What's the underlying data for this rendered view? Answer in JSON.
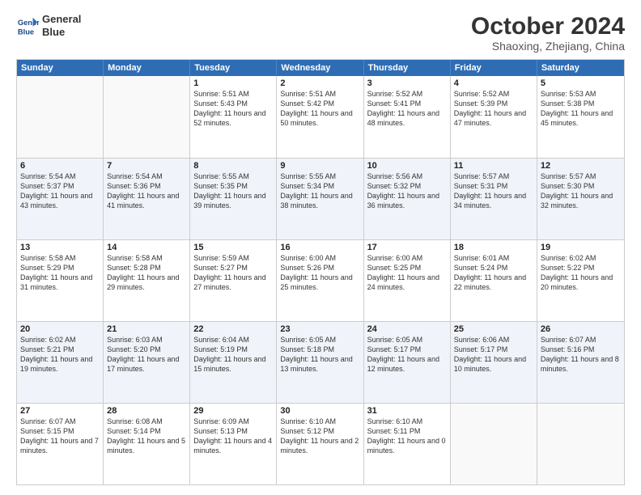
{
  "header": {
    "logo_line1": "General",
    "logo_line2": "Blue",
    "month": "October 2024",
    "location": "Shaoxing, Zhejiang, China"
  },
  "days_of_week": [
    "Sunday",
    "Monday",
    "Tuesday",
    "Wednesday",
    "Thursday",
    "Friday",
    "Saturday"
  ],
  "weeks": [
    [
      {
        "day": "",
        "sunrise": "",
        "sunset": "",
        "daylight": "",
        "empty": true
      },
      {
        "day": "",
        "sunrise": "",
        "sunset": "",
        "daylight": "",
        "empty": true
      },
      {
        "day": "1",
        "sunrise": "Sunrise: 5:51 AM",
        "sunset": "Sunset: 5:43 PM",
        "daylight": "Daylight: 11 hours and 52 minutes."
      },
      {
        "day": "2",
        "sunrise": "Sunrise: 5:51 AM",
        "sunset": "Sunset: 5:42 PM",
        "daylight": "Daylight: 11 hours and 50 minutes."
      },
      {
        "day": "3",
        "sunrise": "Sunrise: 5:52 AM",
        "sunset": "Sunset: 5:41 PM",
        "daylight": "Daylight: 11 hours and 48 minutes."
      },
      {
        "day": "4",
        "sunrise": "Sunrise: 5:52 AM",
        "sunset": "Sunset: 5:39 PM",
        "daylight": "Daylight: 11 hours and 47 minutes."
      },
      {
        "day": "5",
        "sunrise": "Sunrise: 5:53 AM",
        "sunset": "Sunset: 5:38 PM",
        "daylight": "Daylight: 11 hours and 45 minutes."
      }
    ],
    [
      {
        "day": "6",
        "sunrise": "Sunrise: 5:54 AM",
        "sunset": "Sunset: 5:37 PM",
        "daylight": "Daylight: 11 hours and 43 minutes."
      },
      {
        "day": "7",
        "sunrise": "Sunrise: 5:54 AM",
        "sunset": "Sunset: 5:36 PM",
        "daylight": "Daylight: 11 hours and 41 minutes."
      },
      {
        "day": "8",
        "sunrise": "Sunrise: 5:55 AM",
        "sunset": "Sunset: 5:35 PM",
        "daylight": "Daylight: 11 hours and 39 minutes."
      },
      {
        "day": "9",
        "sunrise": "Sunrise: 5:55 AM",
        "sunset": "Sunset: 5:34 PM",
        "daylight": "Daylight: 11 hours and 38 minutes."
      },
      {
        "day": "10",
        "sunrise": "Sunrise: 5:56 AM",
        "sunset": "Sunset: 5:32 PM",
        "daylight": "Daylight: 11 hours and 36 minutes."
      },
      {
        "day": "11",
        "sunrise": "Sunrise: 5:57 AM",
        "sunset": "Sunset: 5:31 PM",
        "daylight": "Daylight: 11 hours and 34 minutes."
      },
      {
        "day": "12",
        "sunrise": "Sunrise: 5:57 AM",
        "sunset": "Sunset: 5:30 PM",
        "daylight": "Daylight: 11 hours and 32 minutes."
      }
    ],
    [
      {
        "day": "13",
        "sunrise": "Sunrise: 5:58 AM",
        "sunset": "Sunset: 5:29 PM",
        "daylight": "Daylight: 11 hours and 31 minutes."
      },
      {
        "day": "14",
        "sunrise": "Sunrise: 5:58 AM",
        "sunset": "Sunset: 5:28 PM",
        "daylight": "Daylight: 11 hours and 29 minutes."
      },
      {
        "day": "15",
        "sunrise": "Sunrise: 5:59 AM",
        "sunset": "Sunset: 5:27 PM",
        "daylight": "Daylight: 11 hours and 27 minutes."
      },
      {
        "day": "16",
        "sunrise": "Sunrise: 6:00 AM",
        "sunset": "Sunset: 5:26 PM",
        "daylight": "Daylight: 11 hours and 25 minutes."
      },
      {
        "day": "17",
        "sunrise": "Sunrise: 6:00 AM",
        "sunset": "Sunset: 5:25 PM",
        "daylight": "Daylight: 11 hours and 24 minutes."
      },
      {
        "day": "18",
        "sunrise": "Sunrise: 6:01 AM",
        "sunset": "Sunset: 5:24 PM",
        "daylight": "Daylight: 11 hours and 22 minutes."
      },
      {
        "day": "19",
        "sunrise": "Sunrise: 6:02 AM",
        "sunset": "Sunset: 5:22 PM",
        "daylight": "Daylight: 11 hours and 20 minutes."
      }
    ],
    [
      {
        "day": "20",
        "sunrise": "Sunrise: 6:02 AM",
        "sunset": "Sunset: 5:21 PM",
        "daylight": "Daylight: 11 hours and 19 minutes."
      },
      {
        "day": "21",
        "sunrise": "Sunrise: 6:03 AM",
        "sunset": "Sunset: 5:20 PM",
        "daylight": "Daylight: 11 hours and 17 minutes."
      },
      {
        "day": "22",
        "sunrise": "Sunrise: 6:04 AM",
        "sunset": "Sunset: 5:19 PM",
        "daylight": "Daylight: 11 hours and 15 minutes."
      },
      {
        "day": "23",
        "sunrise": "Sunrise: 6:05 AM",
        "sunset": "Sunset: 5:18 PM",
        "daylight": "Daylight: 11 hours and 13 minutes."
      },
      {
        "day": "24",
        "sunrise": "Sunrise: 6:05 AM",
        "sunset": "Sunset: 5:17 PM",
        "daylight": "Daylight: 11 hours and 12 minutes."
      },
      {
        "day": "25",
        "sunrise": "Sunrise: 6:06 AM",
        "sunset": "Sunset: 5:17 PM",
        "daylight": "Daylight: 11 hours and 10 minutes."
      },
      {
        "day": "26",
        "sunrise": "Sunrise: 6:07 AM",
        "sunset": "Sunset: 5:16 PM",
        "daylight": "Daylight: 11 hours and 8 minutes."
      }
    ],
    [
      {
        "day": "27",
        "sunrise": "Sunrise: 6:07 AM",
        "sunset": "Sunset: 5:15 PM",
        "daylight": "Daylight: 11 hours and 7 minutes."
      },
      {
        "day": "28",
        "sunrise": "Sunrise: 6:08 AM",
        "sunset": "Sunset: 5:14 PM",
        "daylight": "Daylight: 11 hours and 5 minutes."
      },
      {
        "day": "29",
        "sunrise": "Sunrise: 6:09 AM",
        "sunset": "Sunset: 5:13 PM",
        "daylight": "Daylight: 11 hours and 4 minutes."
      },
      {
        "day": "30",
        "sunrise": "Sunrise: 6:10 AM",
        "sunset": "Sunset: 5:12 PM",
        "daylight": "Daylight: 11 hours and 2 minutes."
      },
      {
        "day": "31",
        "sunrise": "Sunrise: 6:10 AM",
        "sunset": "Sunset: 5:11 PM",
        "daylight": "Daylight: 11 hours and 0 minutes."
      },
      {
        "day": "",
        "sunrise": "",
        "sunset": "",
        "daylight": "",
        "empty": true
      },
      {
        "day": "",
        "sunrise": "",
        "sunset": "",
        "daylight": "",
        "empty": true
      }
    ]
  ]
}
